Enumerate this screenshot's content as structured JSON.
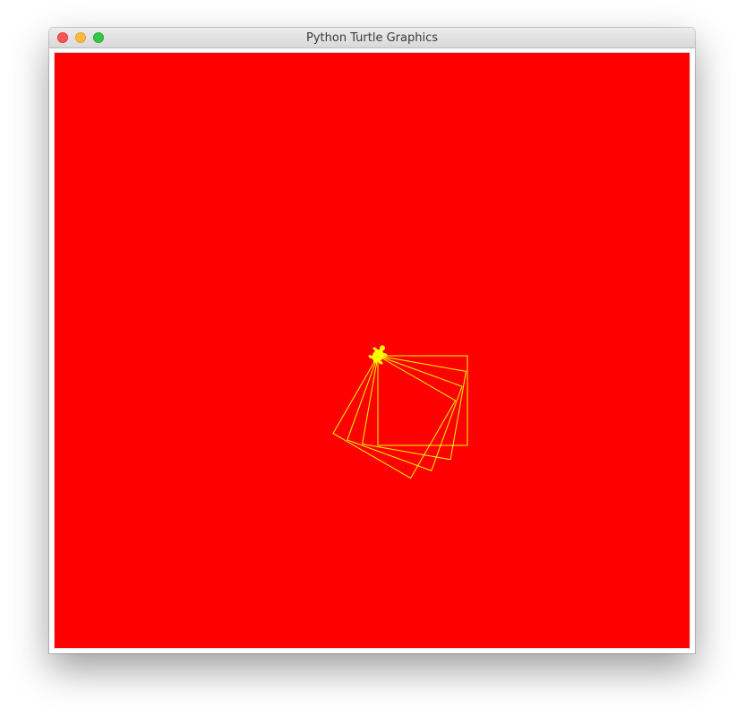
{
  "window": {
    "title": "Python Turtle Graphics",
    "buttons": [
      {
        "name": "close",
        "color": "#fc5753"
      },
      {
        "name": "minimize",
        "color": "#fdbc40"
      },
      {
        "name": "zoom",
        "color": "#33c748"
      }
    ]
  },
  "canvas": {
    "background_color": "#ff0000",
    "pen_color": "#ffff00",
    "turtle_color": "#ffff00",
    "turtle_shape": "turtle-icon",
    "drawing": {
      "shape": "square",
      "count": 4
    }
  }
}
